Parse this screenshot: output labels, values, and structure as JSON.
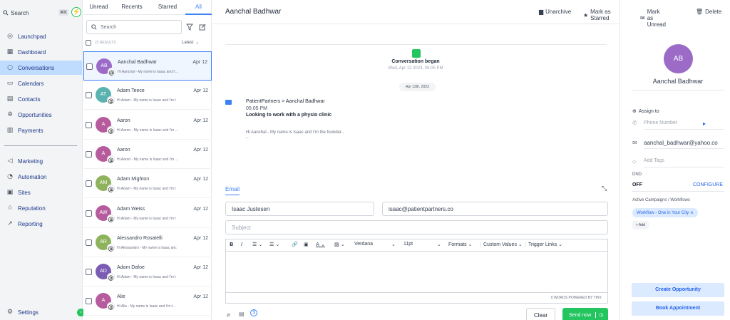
{
  "sidebar": {
    "search_label": "Search",
    "shortcut": "⌘K",
    "items": [
      {
        "label": "Launchpad",
        "icon": "rocket-icon"
      },
      {
        "label": "Dashboard",
        "icon": "grid-icon"
      },
      {
        "label": "Conversations",
        "icon": "chat-icon"
      },
      {
        "label": "Calendars",
        "icon": "calendar-icon"
      },
      {
        "label": "Contacts",
        "icon": "contacts-icon"
      },
      {
        "label": "Opportunities",
        "icon": "opportunities-icon"
      },
      {
        "label": "Payments",
        "icon": "payments-icon"
      },
      {
        "label": "Marketing",
        "icon": "send-icon"
      },
      {
        "label": "Automation",
        "icon": "automation-icon"
      },
      {
        "label": "Sites",
        "icon": "sites-icon"
      },
      {
        "label": "Reputation",
        "icon": "star-icon"
      },
      {
        "label": "Reporting",
        "icon": "chart-line-icon"
      }
    ],
    "settings_label": "Settings"
  },
  "list": {
    "tabs": [
      "Unread",
      "Recents",
      "Starred",
      "All"
    ],
    "search_placeholder": "Search",
    "results_count": "22 RESULTS",
    "sort_label": "Latest",
    "rows": [
      {
        "initials": "AB",
        "name": "Aanchal Badhwar",
        "date": "Apr 12",
        "preview": "Hi Aanchal - My name is Isaac and I'...",
        "color": "#9b6bc7"
      },
      {
        "initials": "AT",
        "name": "Adam Teece",
        "date": "Apr 12",
        "preview": "Hi Adam - My name is Isaac and I'm t",
        "color": "#5ab3b0"
      },
      {
        "initials": "A",
        "name": "Aaron",
        "date": "Apr 12",
        "preview": "Hi Aaron - My name is Isaac and I'm ...",
        "color": "#b65c9d"
      },
      {
        "initials": "A",
        "name": "Aaron",
        "date": "Apr 12",
        "preview": "Hi Aaron - My name is Isaac and I'm ...",
        "color": "#b65c9d"
      },
      {
        "initials": "AM",
        "name": "Adam Mighton",
        "date": "Apr 12",
        "preview": "Hi Adam - My name is Isaac and I'm t",
        "color": "#8fb35c"
      },
      {
        "initials": "AW",
        "name": "Adam Weiss",
        "date": "Apr 12",
        "preview": "Hi Adam - My name is Isaac and I'm t",
        "color": "#b65c9d"
      },
      {
        "initials": "AR",
        "name": "Alessandro Rosatelli",
        "date": "Apr 12",
        "preview": "Hi Alessandro - My name is Isaac anc",
        "color": "#8fb35c"
      },
      {
        "initials": "AD",
        "name": "Adam Dafoe",
        "date": "Apr 12",
        "preview": "Hi Adam - My name is Isaac and I'm t",
        "color": "#7a5cb3"
      },
      {
        "initials": "A",
        "name": "Alie",
        "date": "Apr 12",
        "preview": "Hi Alie - My name is Isaac and I'm t...",
        "color": "#b65c9d"
      }
    ]
  },
  "main": {
    "title": "Aanchal Badhwar",
    "actions": [
      "Unarchive",
      "Mark as Starred",
      "Mark as Unread",
      "Delete"
    ],
    "began_title": "Conversation began",
    "began_date": "Wed, Apr 12 2023, 05:05 PM",
    "date_pill": "Apr 12th, 2023",
    "message": {
      "route": "PatientPartners > Aanchal Badhwar",
      "time": "05:05 PM",
      "subject": "Looking to work with a physio clinic",
      "body": "Hi Aanchal - My name is Isaac and I'm the founder...",
      "more": "..."
    },
    "composer": {
      "tab": "Email",
      "from_name": "Isaac Justesen",
      "from_email": "isaac@patientpartners.co",
      "subject_placeholder": "Subject",
      "font": "Verdana",
      "size": "11pt",
      "formats": "Formats",
      "custom_values": "Custom Values",
      "trigger_links": "Trigger Links",
      "footer": "0 WORDS POWERED BY TINY",
      "clear": "Clear",
      "send": "Send now"
    }
  },
  "contact": {
    "initials": "AB",
    "name": "Aanchal Badhwar",
    "assign": "Assign to",
    "phone_placeholder": "Phone Number",
    "email": "aanchal_badhwar@yahoo.co",
    "tags_placeholder": "Add Tags",
    "dnd_label": "DND",
    "dnd_value": "OFF",
    "configure": "CONFIGURE",
    "campaigns_label": "Active Campaigns / Workflows",
    "workflow": "Workflow - One in Your City",
    "add": "+ Add",
    "create_opportunity": "Create Opportunity",
    "book_appointment": "Book Appointment"
  },
  "colors": {
    "accent": "#3b82f6",
    "send": "#22c55e",
    "selected_nav": "#bfdbfe"
  }
}
